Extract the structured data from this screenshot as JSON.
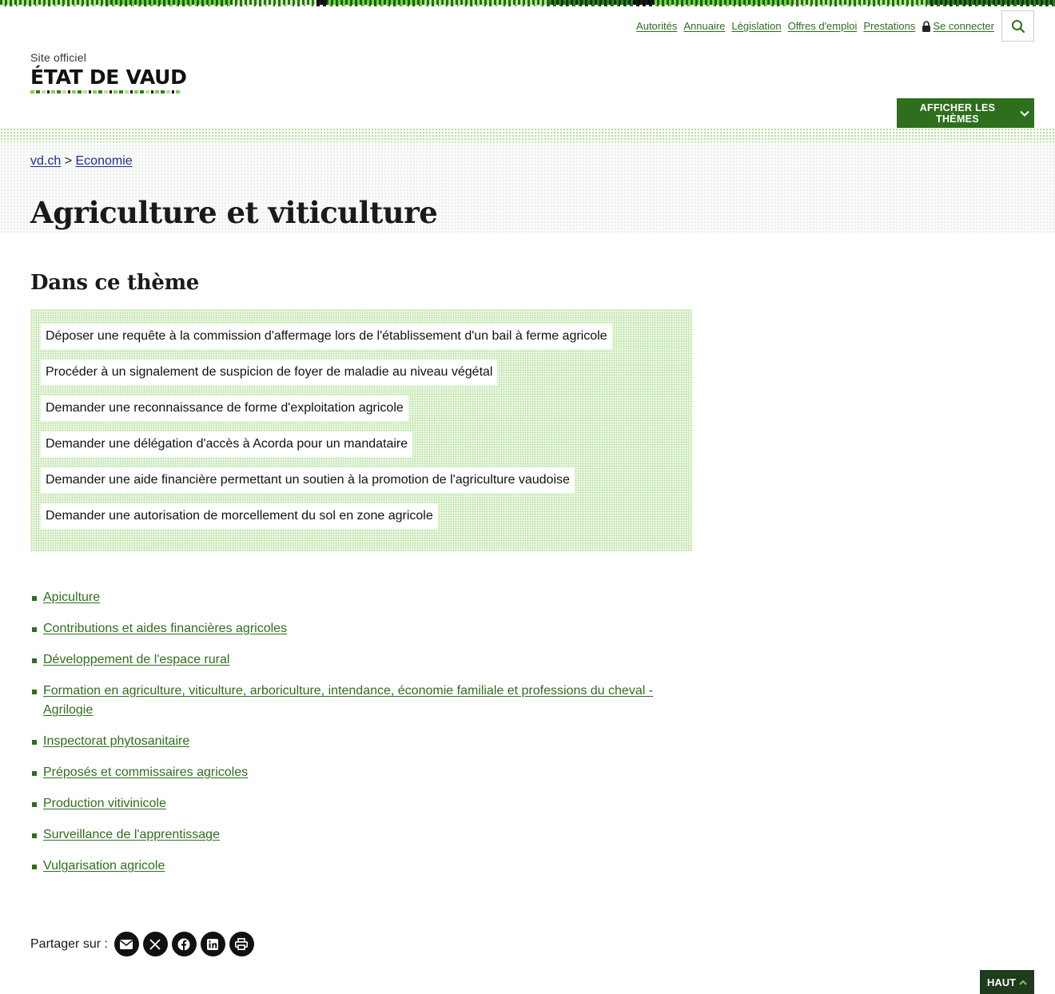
{
  "utility_nav": {
    "items": [
      {
        "label": "Autorités"
      },
      {
        "label": "Annuaire"
      },
      {
        "label": "Législation"
      },
      {
        "label": "Offres d'emploi"
      },
      {
        "label": "Prestations"
      }
    ],
    "login_label": "Se connecter",
    "icons": {
      "login": "lock-icon",
      "search": "search-icon"
    }
  },
  "brand": {
    "small": "Site officiel",
    "name": "ÉTAT DE VAUD"
  },
  "themes_button": {
    "label": "AFFICHER LES THÈMES",
    "icon": "chevron-down-icon"
  },
  "breadcrumb": {
    "home": "vd.ch",
    "separator": ">",
    "current": "Economie"
  },
  "page": {
    "title": "Agriculture et viticulture"
  },
  "in_theme": {
    "title": "Dans ce thème",
    "items": [
      "Déposer une requête à la commission d'affermage lors de l'établissement d'un bail à ferme agricole",
      "Procéder à un signalement de suspicion de foyer de maladie au niveau végétal",
      "Demander une reconnaissance de forme d'exploitation agricole",
      "Demander une délégation d'accès à Acorda pour un mandataire",
      "Demander une aide financière permettant un soutien à la promotion de l'agriculture vaudoise",
      "Demander une autorisation de morcellement du sol en zone agricole"
    ]
  },
  "links": [
    "Apiculture",
    "Contributions et aides financières agricoles",
    "Développement de l'espace rural",
    "Formation en agriculture, viticulture, arboriculture, intendance, économie familiale et professions du cheval - Agrilogie",
    "Inspectorat phytosanitaire",
    "Préposés et commissaires agricoles",
    "Production vitivinicole",
    "Surveillance de l'apprentissage",
    "Vulgarisation agricole"
  ],
  "share": {
    "label": "Partager sur :",
    "icons": [
      "email-icon",
      "x-icon",
      "facebook-icon",
      "linkedin-icon",
      "print-icon"
    ]
  },
  "back_to_top": {
    "label": "HAUT",
    "icon": "chevron-up-icon"
  },
  "colors": {
    "accent_green": "#2e6e1d",
    "breadcrumb_link": "#1f2f8f",
    "top_button": "#1e3b1c"
  }
}
